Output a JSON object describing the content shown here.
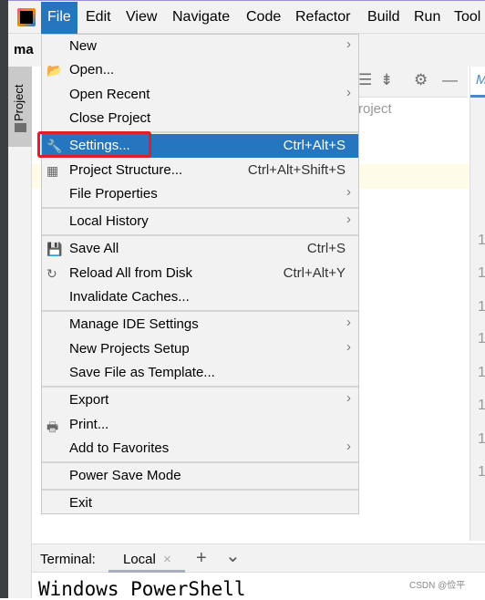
{
  "menubar": {
    "items": [
      "File",
      "Edit",
      "View",
      "Navigate",
      "Code",
      "Refactor",
      "Build",
      "Run",
      "Tool"
    ],
    "active": "File"
  },
  "project_name_partial": "ma",
  "side_tab": "Project",
  "editor_hint_partial": "roject",
  "line_numbers": [
    "1",
    "1",
    "1",
    "1",
    "1",
    "1",
    "1",
    "1"
  ],
  "file_menu": {
    "items": [
      {
        "label": "New",
        "submenu": true
      },
      {
        "label": "Open...",
        "icon": "folder-open-icon"
      },
      {
        "label": "Open Recent",
        "submenu": true
      },
      {
        "label": "Close Project",
        "sep_after": true
      },
      {
        "label": "Settings...",
        "shortcut": "Ctrl+Alt+S",
        "icon": "wrench-icon",
        "selected": true
      },
      {
        "label": "Project Structure...",
        "shortcut": "Ctrl+Alt+Shift+S",
        "icon": "project-structure-icon"
      },
      {
        "label": "File Properties",
        "submenu": true,
        "sep_after": true
      },
      {
        "label": "Local History",
        "submenu": true,
        "sep_after": true
      },
      {
        "label": "Save All",
        "shortcut": "Ctrl+S",
        "icon": "save-icon"
      },
      {
        "label": "Reload All from Disk",
        "shortcut": "Ctrl+Alt+Y",
        "icon": "reload-icon"
      },
      {
        "label": "Invalidate Caches...",
        "sep_after": true
      },
      {
        "label": "Manage IDE Settings",
        "submenu": true
      },
      {
        "label": "New Projects Setup",
        "submenu": true
      },
      {
        "label": "Save File as Template...",
        "sep_after": true
      },
      {
        "label": "Export",
        "submenu": true
      },
      {
        "label": "Print...",
        "icon": "printer-icon"
      },
      {
        "label": "Add to Favorites",
        "submenu": true,
        "sep_after": true
      },
      {
        "label": "Power Save Mode",
        "sep_after": true
      },
      {
        "label": "Exit"
      }
    ]
  },
  "terminal": {
    "label": "Terminal:",
    "tab": "Local",
    "close": "×",
    "add": "+",
    "dropdown": "⌄",
    "output": "Windows PowerShell"
  },
  "watermark": "CSDN @俭平",
  "colors": {
    "accent": "#2675bf",
    "highlight_box": "#e11d2a"
  }
}
